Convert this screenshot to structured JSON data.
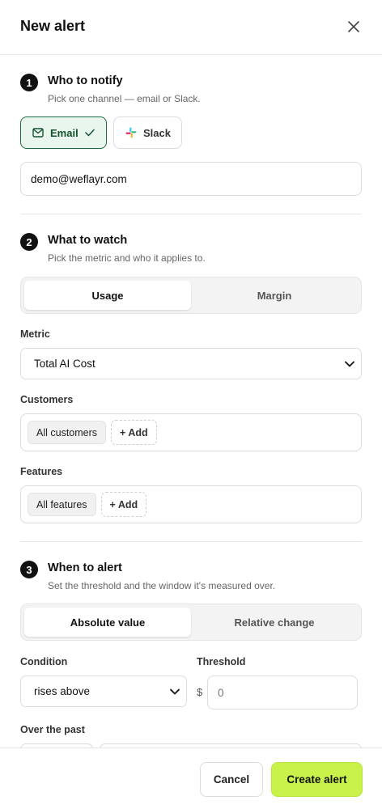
{
  "header": {
    "title": "New alert"
  },
  "step1": {
    "number": "1",
    "title": "Who to notify",
    "subtitle": "Pick one channel — email or Slack.",
    "channels": [
      {
        "label": "Email",
        "selected": true
      },
      {
        "label": "Slack",
        "selected": false
      }
    ],
    "email_value": "demo@weflayr.com"
  },
  "step2": {
    "number": "2",
    "title": "What to watch",
    "subtitle": "Pick the metric and who it applies to.",
    "tabs": [
      {
        "label": "Usage",
        "selected": true
      },
      {
        "label": "Margin",
        "selected": false
      }
    ],
    "metric_label": "Metric",
    "metric_value": "Total AI Cost",
    "customers_label": "Customers",
    "customers_tag": "All customers",
    "features_label": "Features",
    "features_tag": "All features",
    "add_label": "+ Add"
  },
  "step3": {
    "number": "3",
    "title": "When to alert",
    "subtitle": "Set the threshold and the window it's measured over.",
    "tabs": [
      {
        "label": "Absolute value",
        "selected": true
      },
      {
        "label": "Relative change",
        "selected": false
      }
    ],
    "condition_label": "Condition",
    "condition_value": "rises above",
    "threshold_label": "Threshold",
    "currency_symbol": "$",
    "threshold_placeholder": "0",
    "window_label": "Over the past"
  },
  "footer": {
    "cancel_label": "Cancel",
    "create_label": "Create alert"
  },
  "colors": {
    "accent": "#c8f24a",
    "selected_bg": "#e9f6ee",
    "selected_border": "#1f6b43"
  }
}
